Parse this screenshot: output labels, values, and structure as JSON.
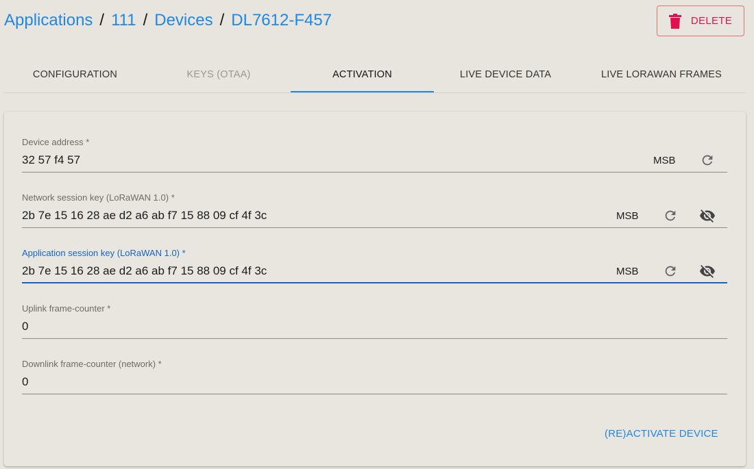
{
  "breadcrumb": {
    "applications": "Applications",
    "app_id": "111",
    "devices": "Devices",
    "device": "DL7612-F457",
    "separator": "/"
  },
  "header": {
    "delete_label": "DELETE"
  },
  "tabs": [
    {
      "label": "CONFIGURATION",
      "state": "normal"
    },
    {
      "label": "KEYS (OTAA)",
      "state": "disabled"
    },
    {
      "label": "ACTIVATION",
      "state": "active"
    },
    {
      "label": "LIVE DEVICE DATA",
      "state": "normal"
    },
    {
      "label": "LIVE LORAWAN FRAMES",
      "state": "normal"
    }
  ],
  "form": {
    "device_address": {
      "label": "Device address *",
      "value": "32 57 f4 57",
      "msb": "MSB"
    },
    "nwk_s_key": {
      "label": "Network session key (LoRaWAN 1.0) *",
      "value": "2b 7e 15 16 28 ae d2 a6 ab f7 15 88 09 cf 4f 3c",
      "msb": "MSB"
    },
    "app_s_key": {
      "label": "Application session key (LoRaWAN 1.0) *",
      "value": "2b 7e 15 16 28 ae d2 a6 ab f7 15 88 09 cf 4f 3c",
      "msb": "MSB"
    },
    "f_cnt_up": {
      "label": "Uplink frame-counter *",
      "value": "0"
    },
    "n_f_cnt_down": {
      "label": "Downlink frame-counter (network) *",
      "value": "0"
    }
  },
  "actions": {
    "activate_label": "(RE)ACTIVATE DEVICE"
  },
  "colors": {
    "link": "#1e88e5",
    "delete": "#e0114f",
    "focus": "#1565c0"
  },
  "icons": {
    "delete": "trash-icon",
    "refresh": "refresh-icon",
    "visibility": "visibility-off-icon"
  }
}
